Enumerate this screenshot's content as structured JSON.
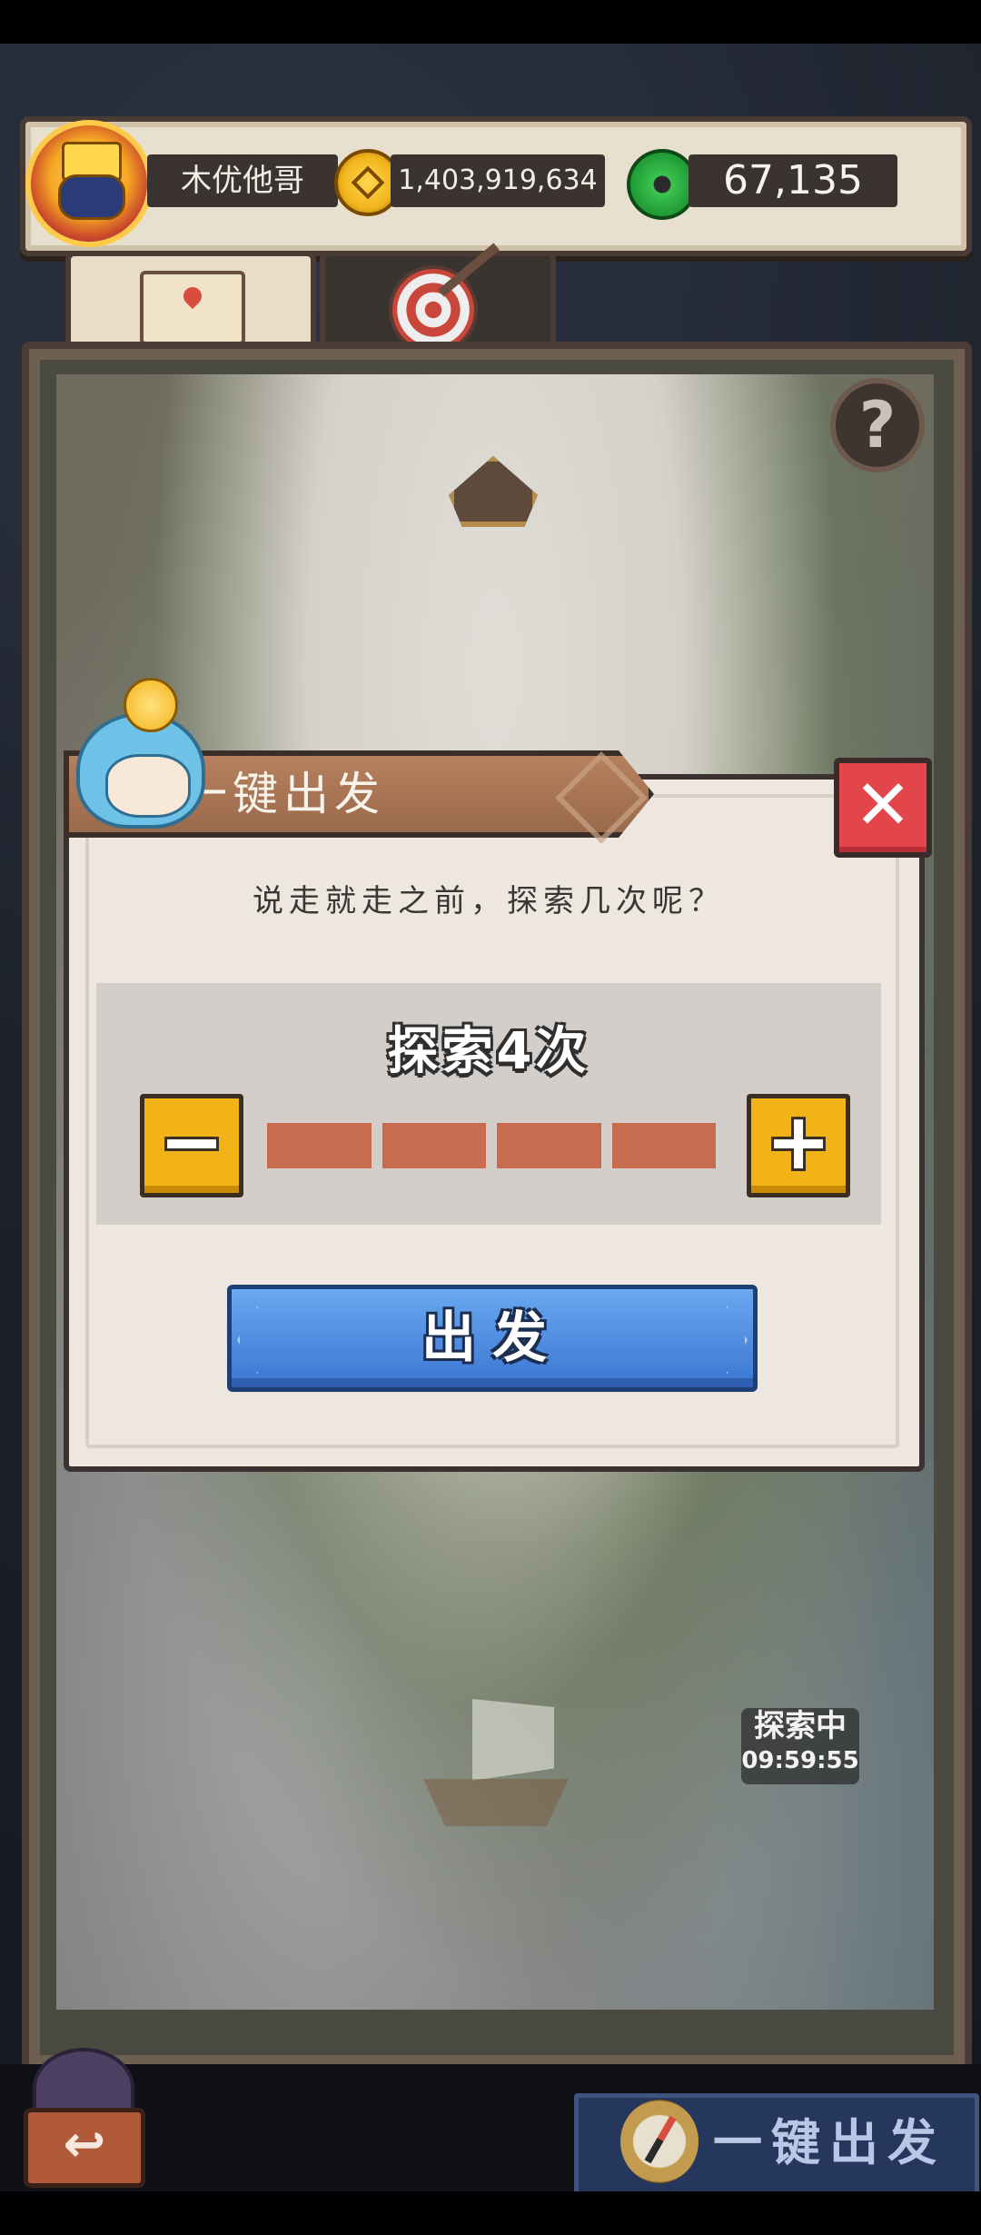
{
  "player": {
    "name": "木优他哥",
    "coins": "1,403,919,634",
    "jade": "67,135"
  },
  "tabs": [
    {
      "name": "map-tab",
      "icon": "map-icon",
      "selected": true
    },
    {
      "name": "target-tab",
      "icon": "target-icon",
      "selected": false
    }
  ],
  "map": {
    "help_label": "?",
    "explore_status": {
      "label": "探索中",
      "timer": "09:59:55"
    }
  },
  "dialog": {
    "title": "一键出发",
    "close_label": "✕",
    "prompt": "说走就走之前，探索几次呢？",
    "count_label": "探索4次",
    "count_value": 4,
    "count_max": 4,
    "minus_label": "−",
    "plus_label": "+",
    "go_label": "出发"
  },
  "bottom": {
    "back_label": "↩",
    "quick_start_label": "一键出发"
  },
  "colors": {
    "go_button": "#3a76d2",
    "close_button": "#e2464b",
    "stepper": "#f2b318",
    "segment_fill": "#c86c50"
  }
}
